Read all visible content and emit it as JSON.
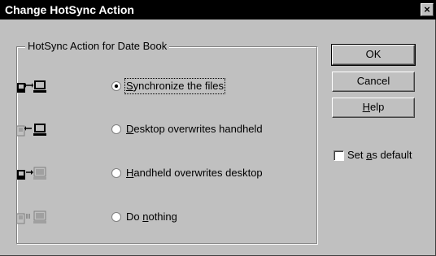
{
  "window": {
    "title": "Change HotSync Action",
    "close_glyph": "×"
  },
  "group": {
    "legend": "HotSync Action for Date Book"
  },
  "options": [
    {
      "pre": "",
      "mnemonic": "S",
      "post": "ynchronize the files",
      "selected": true,
      "icon": "sync-both-icon"
    },
    {
      "pre": "",
      "mnemonic": "D",
      "post": "esktop overwrites handheld",
      "selected": false,
      "icon": "desktop-to-handheld-icon"
    },
    {
      "pre": "",
      "mnemonic": "H",
      "post": "andheld overwrites desktop",
      "selected": false,
      "icon": "handheld-to-desktop-icon"
    },
    {
      "pre": "Do ",
      "mnemonic": "n",
      "post": "othing",
      "selected": false,
      "icon": "do-nothing-icon"
    }
  ],
  "buttons": {
    "ok": "OK",
    "cancel": "Cancel",
    "help_mnemonic": "H",
    "help_rest": "elp"
  },
  "default_checkbox": {
    "pre": "Set ",
    "mnemonic": "a",
    "post": "s default",
    "checked": false
  }
}
